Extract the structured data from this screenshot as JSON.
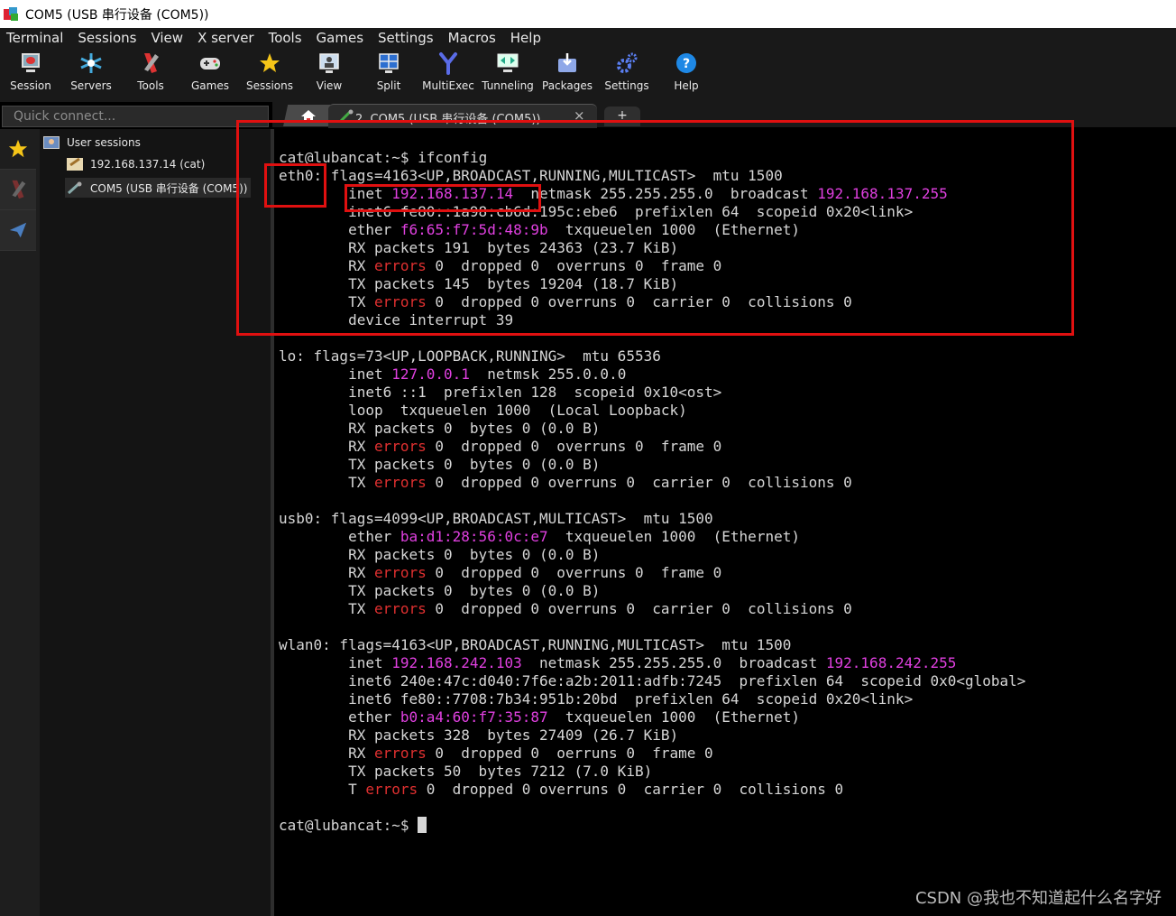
{
  "window": {
    "title": "COM5  (USB 串行设备 (COM5))"
  },
  "menu": [
    "Terminal",
    "Sessions",
    "View",
    "X server",
    "Tools",
    "Games",
    "Settings",
    "Macros",
    "Help"
  ],
  "toolbar": [
    "Session",
    "Servers",
    "Tools",
    "Games",
    "Sessions",
    "View",
    "Split",
    "MultiExec",
    "Tunneling",
    "Packages",
    "Settings",
    "Help"
  ],
  "quick_connect": {
    "placeholder": "Quick connect..."
  },
  "tabs": {
    "active_label": "2. COM5  (USB 串行设备 (COM5))",
    "close": "×",
    "plus": "+"
  },
  "sessions": {
    "root": "User sessions",
    "items": [
      "192.168.137.14 (cat)",
      "COM5  (USB 串行设备 (COM5))"
    ]
  },
  "terminal": {
    "prompt": "cat@lubancat:~$",
    "command": "ifconfig",
    "eth0": {
      "head": "eth0",
      "flags": ": flags=4163<UP,BROADCAST,RUNNING,MULTICAST>  mtu 1500",
      "inet": "192.168.137.14",
      "netmask": "255.255.255.0",
      "broadcast": "192.168.137.255",
      "inet6_line": "        inet6 fe80::1a98:cb6d:195c:ebe6  prefixlen 64  scopeid 0x20<link>",
      "ether": "f6:65:f7:5d:48:9b",
      "ether_tail": "  txqueuelen 1000  (Ethernet)",
      "rx_packets": "        RX packets 191  bytes 24363 (23.7 KiB)",
      "rx_err_tail": " 0  dropped 0  overruns 0  frame 0",
      "tx_packets": "        TX packets 145  bytes 19204 (18.7 KiB)",
      "tx_err_tail": " 0  dropped 0 overruns 0  carrier 0  collisions 0",
      "device": "        device interrupt 39"
    },
    "lo": {
      "flags": "lo: flags=73<UP,LOOPBACK,RUNNING>  mtu 65536",
      "inet": "127.0.0.1",
      "netmask_tail": "  netmsk 255.0.0.0",
      "inet6_line": "        inet6 ::1  prefixlen 128  scopeid 0x10<ost>",
      "loop_line": "        loop  txqueuelen 1000  (Local Loopback)",
      "rx_packets": "        RX packets 0  bytes 0 (0.0 B)",
      "rx_err_tail": " 0  dropped 0  overruns 0  frame 0",
      "tx_packets": "        TX packets 0  bytes 0 (0.0 B)",
      "tx_err_tail": " 0  dropped 0 overruns 0  carrier 0  collisions 0"
    },
    "usb0": {
      "flags": "usb0: flags=4099<UP,BROADCAST,MULTICAST>  mtu 1500",
      "ether": "ba:d1:28:56:0c:e7",
      "ether_tail": "  txqueuelen 1000  (Ethernet)",
      "rx_packets": "        RX packets 0  bytes 0 (0.0 B)",
      "rx_err_tail": " 0  dropped 0  overruns 0  frame 0",
      "tx_packets": "        TX packets 0  bytes 0 (0.0 B)",
      "tx_err_tail": " 0  dropped 0 overruns 0  carrier 0  collisions 0"
    },
    "wlan0": {
      "flags": "wlan0: flags=4163<UP,BROADCAST,RUNNING,MULTICAST>  mtu 1500",
      "inet": "192.168.242.103",
      "netmask_tail": "  netmask 255.255.255.0  broadcast ",
      "broadcast": "192.168.242.255",
      "inet6_a": "        inet6 240e:47c:d040:7f6e:a2b:2011:adfb:7245  prefixlen 64  scopeid 0x0<global>",
      "inet6_b": "        inet6 fe80::7708:7b34:951b:20bd  prefixlen 64  scopeid 0x20<link>",
      "ether": "b0:a4:60:f7:35:87",
      "ether_tail": "  txqueuelen 1000  (Ethernet)",
      "rx_packets": "        RX packets 328  bytes 27409 (26.7 KiB)",
      "rx_err_tail": " 0  dropped 0  oerruns 0  frame 0",
      "tx_packets": "        TX packets 50  bytes 7212 (7.0 KiB)",
      "tx_err_tail": " 0  dropped 0 overruns 0  carrier 0  collisions 0"
    },
    "errors_word": "errors"
  },
  "watermark": "CSDN @我也不知道起什么名字好",
  "colors": {
    "highlight_box": "#e01010",
    "address": "#e040e0",
    "error_word": "#e03030"
  }
}
